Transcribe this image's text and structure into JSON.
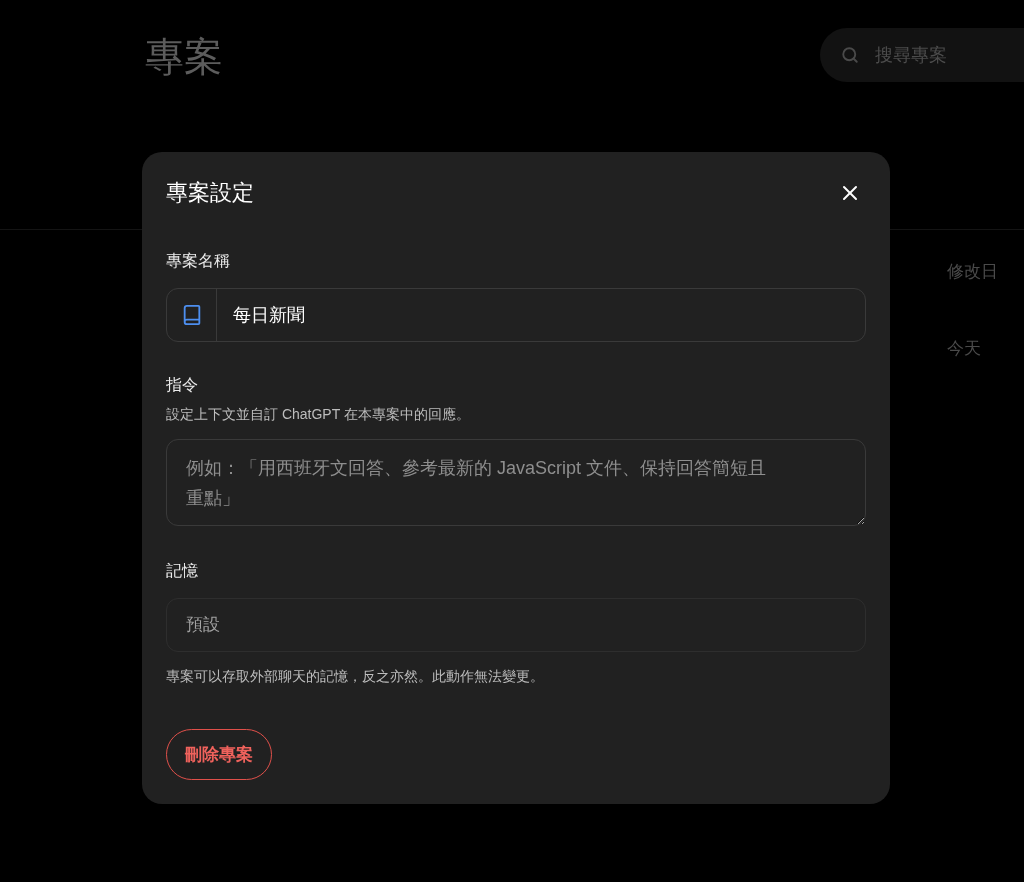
{
  "background_page": {
    "title": "專案",
    "search": {
      "placeholder": "搜尋專案"
    },
    "table": {
      "columns": [
        "修改日"
      ],
      "rows": [
        [
          "今天"
        ]
      ]
    }
  },
  "dialog": {
    "title": "專案設定",
    "name_section": {
      "label": "專案名稱",
      "value": "每日新聞"
    },
    "instructions": {
      "label": "指令",
      "description": "設定上下文並自訂 ChatGPT 在本專案中的回應。",
      "placeholder": "例如：「用西班牙文回答、參考最新的 JavaScript 文件、保持回答簡短且重點」"
    },
    "memory": {
      "label": "記憶",
      "value": "預設",
      "note": "專案可以存取外部聊天的記憶，反之亦然。此動作無法變更。"
    },
    "delete_button": "刪除專案"
  }
}
